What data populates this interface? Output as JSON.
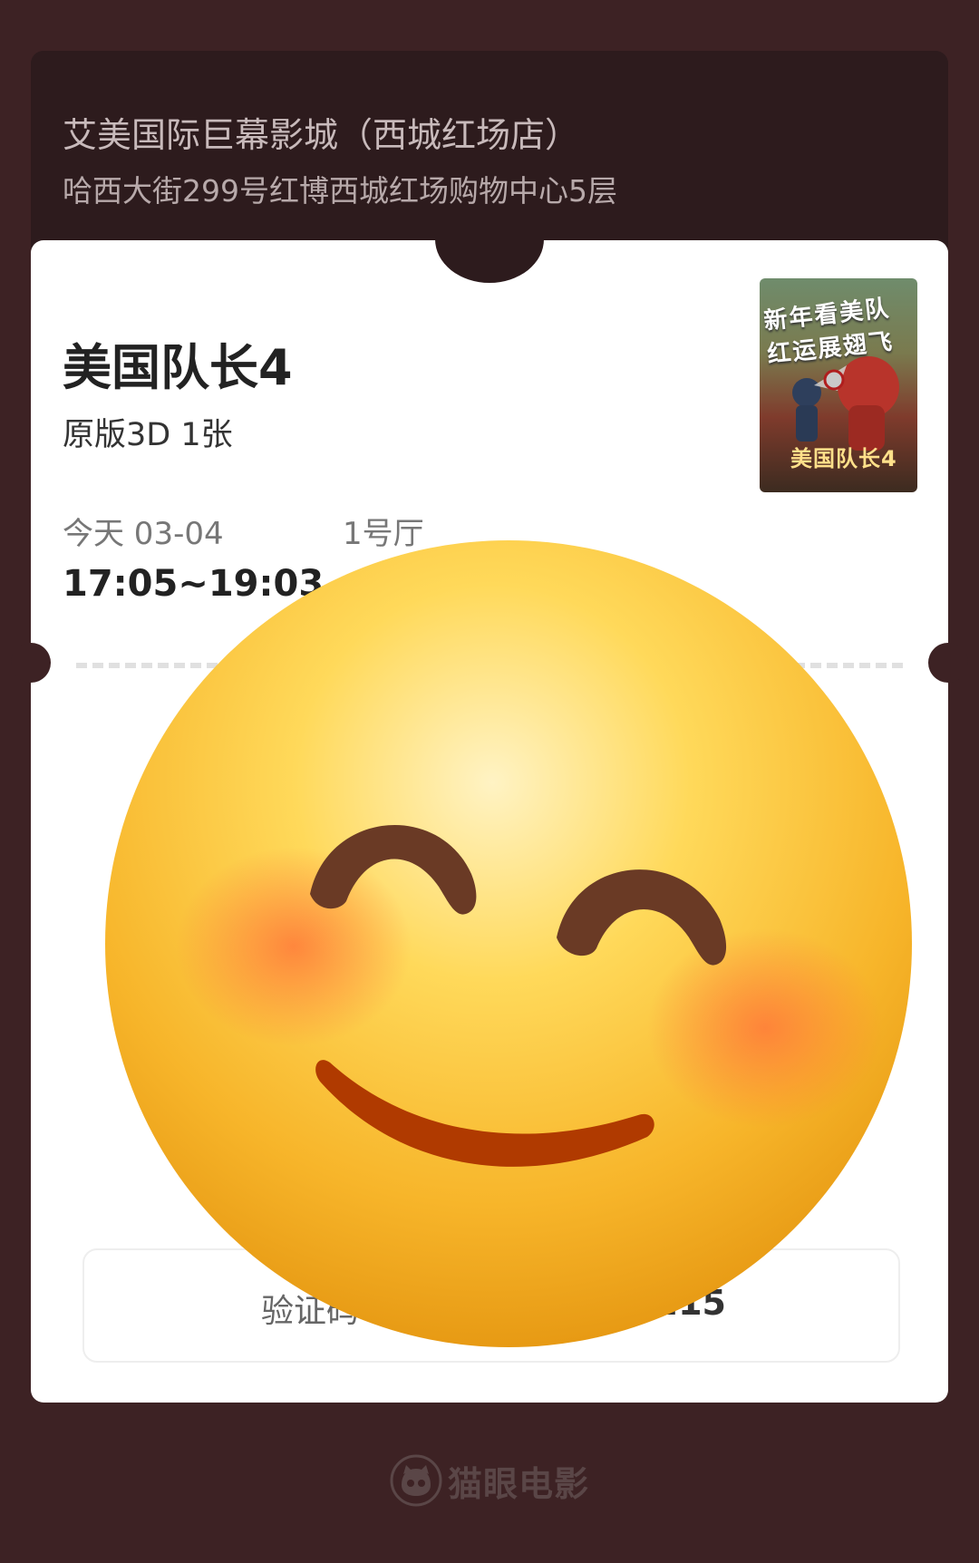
{
  "header": {
    "cinema_name": "艾美国际巨幕影城（西城红场店）",
    "cinema_address": "哈西大街299号红博西城红场购物中心5层"
  },
  "ticket": {
    "movie_title": "美国队长4",
    "format": "原版3D 1张",
    "date": "今天 03-04",
    "hall": "1号厅",
    "time": "17:05~19:03",
    "code_label": "验证码",
    "code_value": "215"
  },
  "poster": {
    "headline": "新年看美队 红运展翅飞",
    "title": "美国队长4"
  },
  "footer": {
    "brand_name": "猫眼电影",
    "brand_icon": "cat-logo-icon"
  },
  "overlay": {
    "icon": "smiling-blush-emoji-icon"
  },
  "colors": {
    "background": "#3d2224",
    "header_card": "#2d1b1d",
    "ticket": "#ffffff",
    "emoji_face": "#fbc02d",
    "emoji_eyes": "#6a3a25",
    "emoji_mouth": "#b03a00"
  }
}
